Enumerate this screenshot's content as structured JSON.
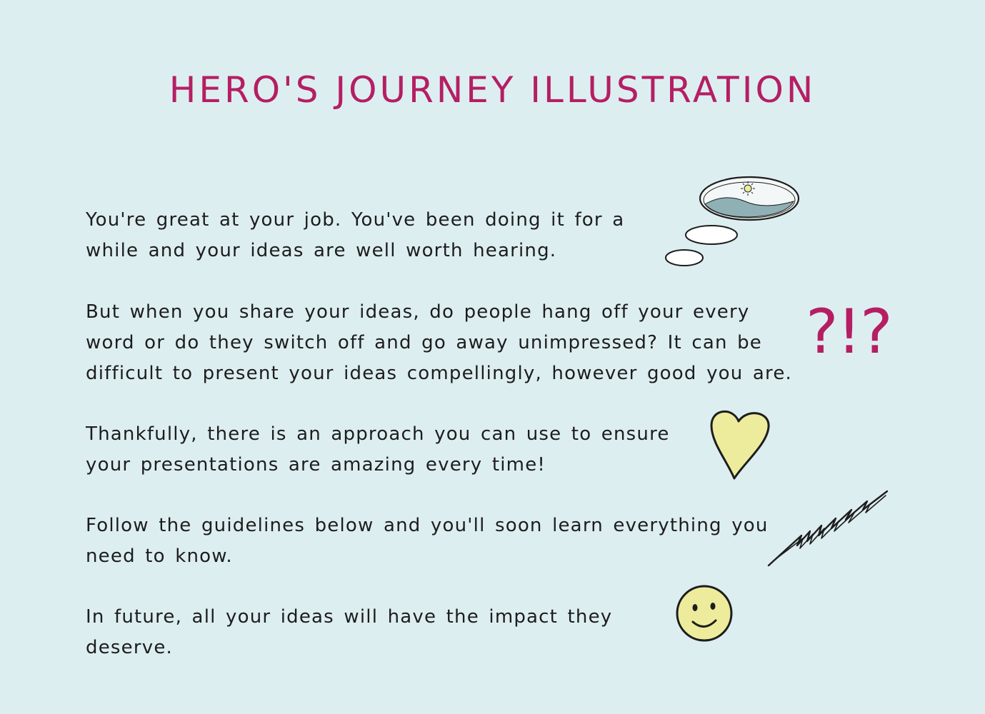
{
  "title": "HERO'S JOURNEY ILLUSTRATION",
  "paragraphs": [
    "You're great at your job. You've been doing it for a while and your ideas are well worth hearing.",
    "But when you share your ideas, do people hang off your every word or do they switch off and go away unimpressed? It can be difficult to present your ideas compellingly, however good you are.",
    "Thankfully, there is an approach you can use to ensure your presentations are amazing every time!",
    "Follow the guidelines below and you'll soon learn everything you need to know.",
    "In future, all your ideas will have the impact they deserve."
  ],
  "doodles": {
    "thought": "thought-bubble-icon",
    "surprise": "?!?",
    "heart": "heart-icon",
    "zigzag": "zigzag-scribble-icon",
    "smiley": "smiley-face-icon"
  },
  "colors": {
    "background": "#ddeef1",
    "accent": "#b51e63",
    "text": "#1d1d1d",
    "yellow": "#ecec9c",
    "hill": "#8fb0b5"
  }
}
